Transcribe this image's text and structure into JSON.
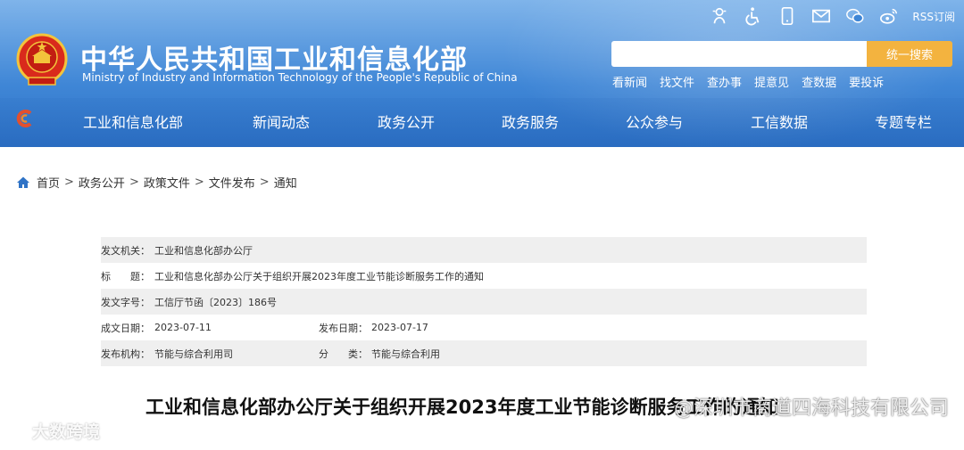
{
  "header": {
    "title": "中华人民共和国工业和信息化部",
    "subtitle": "Ministry of Industry and Information Technology of the People's Republic of China",
    "rss_label": "RSS订阅",
    "top_icons": [
      "assistant-icon",
      "accessibility-icon",
      "mobile-icon",
      "mail-icon",
      "wechat-icon",
      "weibo-icon"
    ]
  },
  "search": {
    "value": "",
    "placeholder": "",
    "button_label": "统一搜索"
  },
  "quick_links": [
    "看新闻",
    "找文件",
    "查办事",
    "提意见",
    "查数据",
    "要投诉"
  ],
  "nav": {
    "items": [
      "工业和信息化部",
      "新闻动态",
      "政务公开",
      "政务服务",
      "公众参与",
      "工信数据",
      "专题专栏"
    ]
  },
  "breadcrumb": [
    "首页",
    "政务公开",
    "政策文件",
    "文件发布",
    "通知"
  ],
  "breadcrumb_sep": ">",
  "doc_info": {
    "issuer_label": "发文机关：",
    "issuer": "工业和信息化部办公厅",
    "title_label": "标　　题：",
    "title": "工业和信息化部办公厅关于组织开展2023年度工业节能诊断服务工作的通知",
    "number_label": "发文字号：",
    "number": "工信厅节函〔2023〕186号",
    "written_label": "成文日期：",
    "written_date": "2023-07-11",
    "published_label": "发布日期：",
    "published_date": "2023-07-17",
    "org_label": "发布机构：",
    "org": "节能与综合利用司",
    "category_label": "分　　类：",
    "category": "节能与综合利用"
  },
  "document_title": "工业和信息化部办公厅关于组织开展2023年度工业节能诊断服务工作的通知",
  "watermarks": {
    "left": "大数跨境",
    "right": "@深圳市商道四海科技有限公司"
  },
  "colors": {
    "header_blue": "#3f86d6",
    "search_button": "#f3b33f",
    "row_shade": "#efefef"
  }
}
